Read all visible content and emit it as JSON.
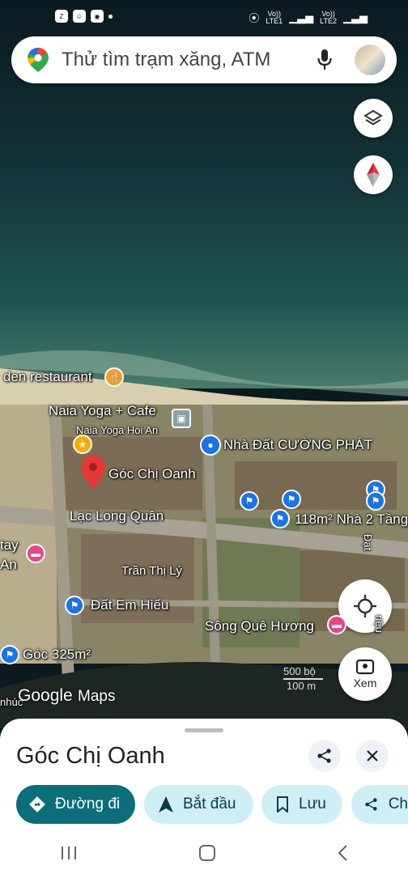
{
  "status_bar": {
    "left_icons": [
      "zalo-icon",
      "face-icon",
      "app-icon"
    ],
    "right_icons": [
      "location-icon",
      "signal-icon",
      "signal-icon",
      "alarm-icon"
    ],
    "sim1_top": "Vo))",
    "sim1_bottom": "LTE1",
    "sim2_top": "Vo))",
    "sim2_bottom": "LTE2"
  },
  "search": {
    "placeholder": "Thử tìm trạm xăng, ATM"
  },
  "map": {
    "labels": {
      "garden_restaurant": "den restaurant",
      "naia_yoga_cafe": "Naia Yoga + Cafe",
      "naia_yoga_hoi_an": "Naia Yoga Hoi An",
      "nha_dat_cuong_phat": "Nhà Đất CƯỜNG PHÁT",
      "goc_chi_oanh": "Góc Chị Oanh",
      "lac_long_quan": "Lạc Long Quân",
      "nha_2_tang": "118m² Nhà 2 Tầng",
      "tay": "tay",
      "an": "An",
      "tran_thi_ly": "Trần Thị Lý",
      "dat_em_hieu": "Đất Em Hiếu",
      "song_que_huong": "Sông Quê Hương",
      "goc_325": "Góc 325m²",
      "nhuc": "nhúc",
      "dat_vertical": "Đạt",
      "trieu_vertical": "riệu"
    },
    "scale": {
      "feet": "500 bộ",
      "meters": "100 m"
    },
    "brand": "Google",
    "brand_suffix": "Maps",
    "streetview_label": "Xem"
  },
  "sheet": {
    "place_name": "Góc Chị Oanh",
    "actions": [
      {
        "label": "Đường đi",
        "icon": "directions-icon"
      },
      {
        "label": "Bắt đầu",
        "icon": "navigation-arrow-icon"
      },
      {
        "label": "Lưu",
        "icon": "bookmark-icon"
      },
      {
        "label": "Ch",
        "icon": "share-icon"
      }
    ]
  },
  "colors": {
    "primary_chip": "#0b6e7a",
    "secondary_chip": "#cfeff6",
    "poi_blue": "#1a73e8",
    "poi_pink": "#e8458b",
    "pin_red": "#e53935"
  }
}
